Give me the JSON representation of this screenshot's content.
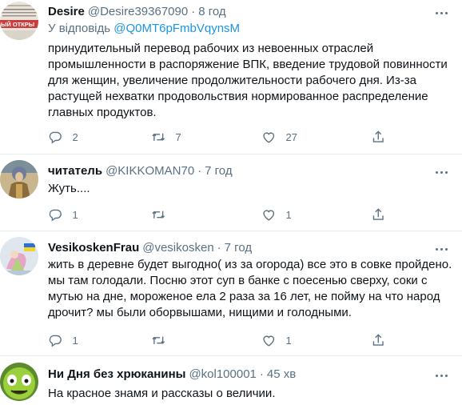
{
  "tweets": [
    {
      "name": "Desire",
      "handle": "@Desire39367090",
      "time": "8 год",
      "reply_prefix": "У відповідь",
      "reply_mention": "@Q0MT6pFmbVqynsM",
      "avatar_text": "ЫЙ ОТКРЫ",
      "text": "принудительный перевод рабочих из невоенных отраслей промышленности в распоряжение ВПК, введение трудовой повинности для женщин, увеличение продолжительности рабочего дня. Из-за растущей нехватки продовольствия нормированное распределение главных продуктов.",
      "replies": "2",
      "retweets": "7",
      "likes": "27"
    },
    {
      "name": "читатель",
      "handle": "@KIKKOMAN70",
      "time": "7 год",
      "text": "Жуть....",
      "replies": "1",
      "retweets": "",
      "likes": "1"
    },
    {
      "name": "VesikoskenFrau",
      "handle": "@vesikosken",
      "time": "7 год",
      "text": "жить в деревне будет выгодно( из за огорода) все это в совке пройдено. мы там голодали. Посню этот суп в банке с поесенью сверху, соки с мутью на дне, мороженое ела 2 раза за 16 лет, не пойму на что народ дрочит? мы были оборвышами, нищими и голодными.",
      "replies": "1",
      "retweets": "",
      "likes": "1"
    },
    {
      "name": "Ни Дня без хрюканины",
      "handle": "@kol100001",
      "time": "45 хв",
      "text": "На красное знамя и рассказы о величии."
    }
  ],
  "separator": "·",
  "colors": {
    "text": "#0f1419",
    "secondary": "#5b7083",
    "link": "#1b95e0",
    "divider": "#e6ecf0"
  }
}
